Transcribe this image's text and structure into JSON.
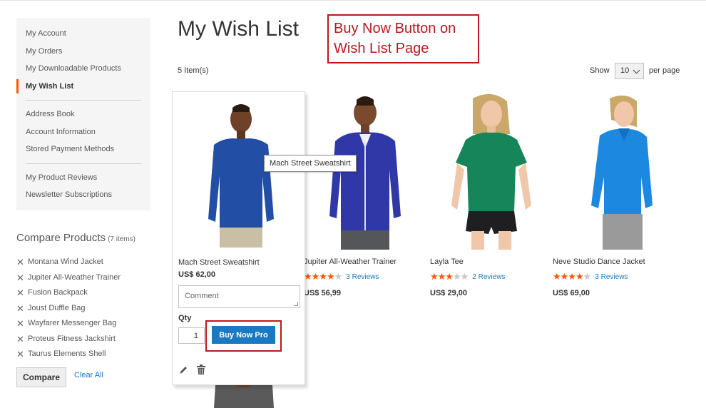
{
  "sidebar": {
    "items": [
      {
        "label": "My Account"
      },
      {
        "label": "My Orders"
      },
      {
        "label": "My Downloadable Products"
      },
      {
        "label": "My Wish List",
        "active": true
      },
      {
        "label": "Address Book"
      },
      {
        "label": "Account Information"
      },
      {
        "label": "Stored Payment Methods"
      },
      {
        "label": "My Product Reviews"
      },
      {
        "label": "Newsletter Subscriptions"
      }
    ]
  },
  "compare": {
    "title": "Compare Products",
    "count": "(7 items)",
    "items": [
      "Montana Wind Jacket",
      "Jupiter All-Weather Trainer",
      "Fusion Backpack",
      "Joust Duffle Bag",
      "Wayfarer Messenger Bag",
      "Proteus Fitness Jackshirt",
      "Taurus Elements Shell"
    ],
    "compare_button": "Compare",
    "clear_all": "Clear All"
  },
  "main": {
    "title": "My Wish List",
    "annotation": "Buy Now Button on Wish List Page",
    "items_count": "5 Item(s)",
    "show_label": "Show",
    "limiter_value": "10",
    "per_page": "per page"
  },
  "tooltip": "Mach Street Sweatshirt",
  "products": [
    {
      "name": "Mach Street Sweatshirt",
      "price": "US$ 62,00",
      "comment_placeholder": "Comment",
      "qty_label": "Qty",
      "qty": "1",
      "buy_label": "Buy Now Pro"
    },
    {
      "name": "Jupiter All-Weather Trainer",
      "rating": 4,
      "reviews": "3  Reviews",
      "price": "US$ 56,99"
    },
    {
      "name": "Layla Tee",
      "rating": 3,
      "reviews": "2  Reviews",
      "price": "US$ 29,00"
    },
    {
      "name": "Neve Studio Dance Jacket",
      "rating": 4.5,
      "reviews": "3  Reviews",
      "price": "US$ 69,00"
    }
  ],
  "colors": {
    "accent": "#1979c3",
    "active_marker": "#ff5501",
    "annotation": "#c0161c",
    "star": "#ff5501",
    "sidebar_bg": "#f5f5f5"
  },
  "icons": [
    "remove-x-icon",
    "chevron-down-icon",
    "edit-pencil-icon",
    "trash-icon",
    "star-icon"
  ]
}
